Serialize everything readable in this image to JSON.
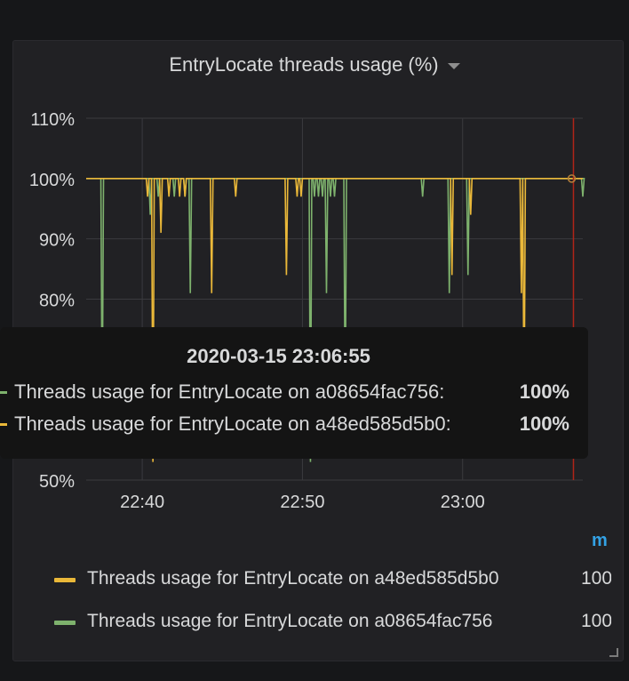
{
  "panel": {
    "title": "EntryLocate threads usage (%)",
    "menu_icon": "caret-down-icon"
  },
  "chart_data": {
    "type": "line",
    "y_unit": "%",
    "ylim": [
      50,
      110
    ],
    "y_ticks": [
      "110%",
      "100%",
      "90%",
      "80%",
      "50%"
    ],
    "x_ticks": [
      "22:40",
      "22:50",
      "23:00"
    ],
    "grid": true,
    "series": [
      {
        "name": "Threads usage for EntryLocate on a48ed585d5b0",
        "color": "#eab839",
        "x": [
          "22:37:00",
          "22:40:20",
          "22:40:40",
          "22:41:10",
          "22:41:40",
          "22:42:20",
          "22:42:40",
          "22:44:20",
          "22:45:50",
          "22:49:00",
          "22:49:40",
          "22:49:55",
          "22:59:20",
          "23:00:30",
          "23:03:40",
          "23:03:50",
          "23:07:00"
        ],
        "y": [
          100,
          97,
          53,
          91,
          97,
          97,
          97,
          81,
          97,
          84,
          97,
          97,
          84,
          94,
          81,
          60,
          100
        ]
      },
      {
        "name": "Threads usage for EntryLocate on a08654fac756",
        "color": "#7eb26d",
        "x": [
          "22:37:00",
          "22:37:30",
          "22:40:30",
          "22:41:00",
          "22:42:00",
          "22:42:40",
          "22:43:00",
          "22:50:30",
          "22:50:45",
          "22:51:00",
          "22:51:15",
          "22:51:30",
          "22:51:45",
          "22:52:00",
          "22:52:40",
          "22:57:30",
          "22:59:10",
          "23:00:20",
          "23:07:30"
        ],
        "y": [
          100,
          60,
          94,
          97,
          97,
          97,
          81,
          53,
          97,
          97,
          97,
          81,
          97,
          97,
          60,
          97,
          81,
          84,
          97
        ]
      }
    ],
    "hover_time": "23:06:55",
    "hover_y": 100
  },
  "tooltip": {
    "time": "2020-03-15 23:06:55",
    "rows": [
      {
        "label": "Threads usage for EntryLocate on a08654fac756:",
        "value": "100%",
        "color": "#7eb26d"
      },
      {
        "label": "Threads usage for EntryLocate on a48ed585d5b0:",
        "value": "100%",
        "color": "#eab839"
      }
    ]
  },
  "legend": {
    "column_header": "m",
    "items": [
      {
        "label": "Threads usage for EntryLocate on a48ed585d5b0",
        "value": "100%",
        "color": "#eab839"
      },
      {
        "label": "Threads usage for EntryLocate on a08654fac756",
        "value": "100%",
        "color": "#7eb26d"
      }
    ]
  }
}
